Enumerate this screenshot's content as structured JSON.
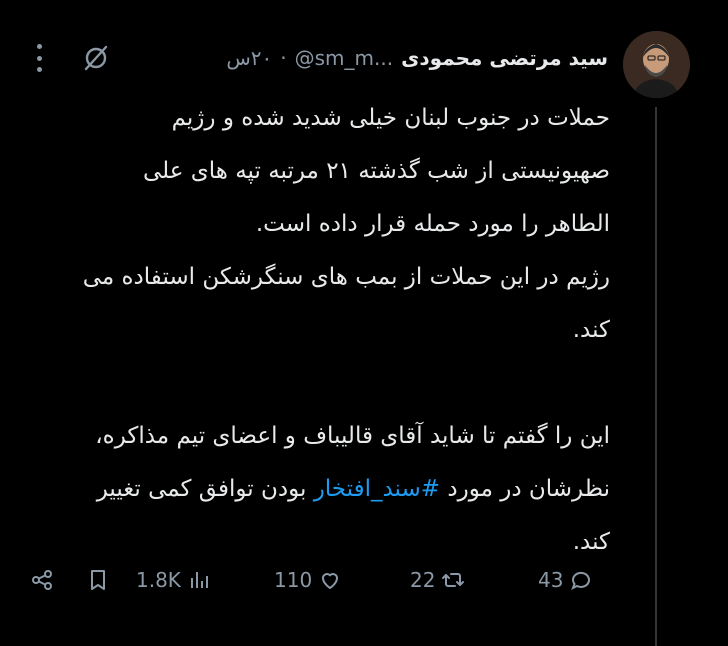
{
  "author": {
    "display_name": "سید مرتضی محمودی",
    "handle": "@sm_m...",
    "separator": "·",
    "time": "۲۰س"
  },
  "tweet": {
    "line1": "حملات در جنوب لبنان خیلی شدید شده و رژیم",
    "line2": "صهیونیستی از شب گذشته ۲۱ مرتبه تپه های علی",
    "line3": "الطاهر را مورد حمله قرار داده است.",
    "line4": "رژیم در این حملات از بمب های سنگرشکن استفاده می",
    "line5": "کند.",
    "line6": "این را گفتم تا شاید آقای قالیباف و اعضای تیم مذاکره،",
    "line7_before": "نظرشان در مورد",
    "hashtag": "#سند_افتخار",
    "line7_after": "بودن توافق کمی تغییر",
    "line8": "کند."
  },
  "actions": {
    "replies": "43",
    "reposts": "22",
    "likes": "110",
    "views": "1.8K"
  },
  "icons": {
    "grok": "grok-icon",
    "more": "more-icon",
    "reply": "reply-icon",
    "repost": "repost-icon",
    "like": "heart-icon",
    "views": "views-chart-icon",
    "bookmark": "bookmark-icon",
    "share": "share-icon"
  },
  "colors": {
    "background": "#000000",
    "text": "#e7e9ea",
    "muted": "#8b98a5",
    "link": "#1d9bf0"
  }
}
